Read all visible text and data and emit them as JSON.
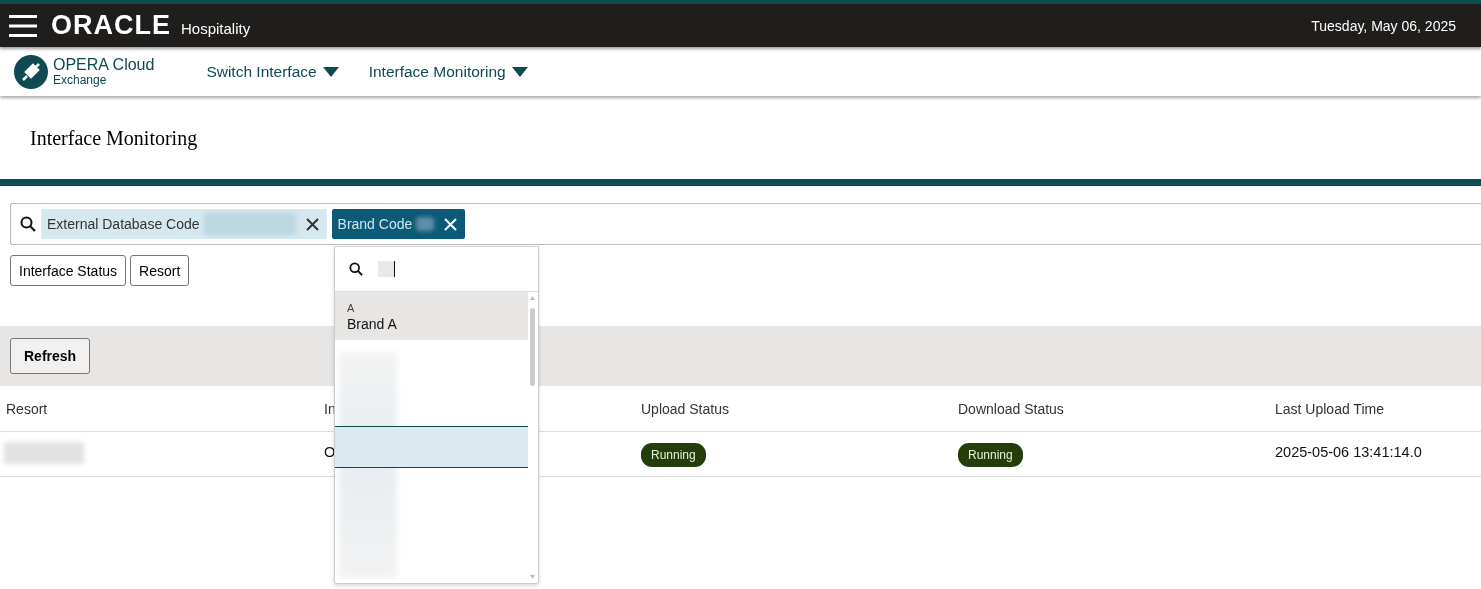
{
  "header": {
    "brand": "ORACLE",
    "product": "Hospitality",
    "date": "Tuesday, May 06, 2025"
  },
  "nav": {
    "app_name": "OPERA Cloud",
    "app_sub": "Exchange",
    "menus": [
      "Switch Interface",
      "Interface Monitoring"
    ]
  },
  "page_title": "Interface Monitoring",
  "filters": [
    {
      "label": "External Database Code",
      "active": false,
      "value_redacted": true
    },
    {
      "label": "Brand Code",
      "active": true,
      "value_redacted": true
    }
  ],
  "facets": [
    "Interface Status",
    "Resort"
  ],
  "refresh": "Refresh",
  "table": {
    "columns": [
      "Resort",
      "In",
      "Upload Status",
      "Download Status",
      "Last Upload Time"
    ],
    "rows": [
      {
        "cells": [
          {
            "redacted": true
          },
          {
            "text": "O"
          },
          {
            "badge": "Running"
          },
          {
            "badge": "Running"
          },
          {
            "text": "2025-05-06 13:41:14.0"
          }
        ]
      }
    ]
  },
  "dropdown": {
    "query_redacted": true,
    "options": [
      {
        "group": "A",
        "label": "Brand A",
        "hovered": true,
        "selected": false
      },
      {
        "redacted": true,
        "hovered": false,
        "selected": true
      }
    ]
  }
}
